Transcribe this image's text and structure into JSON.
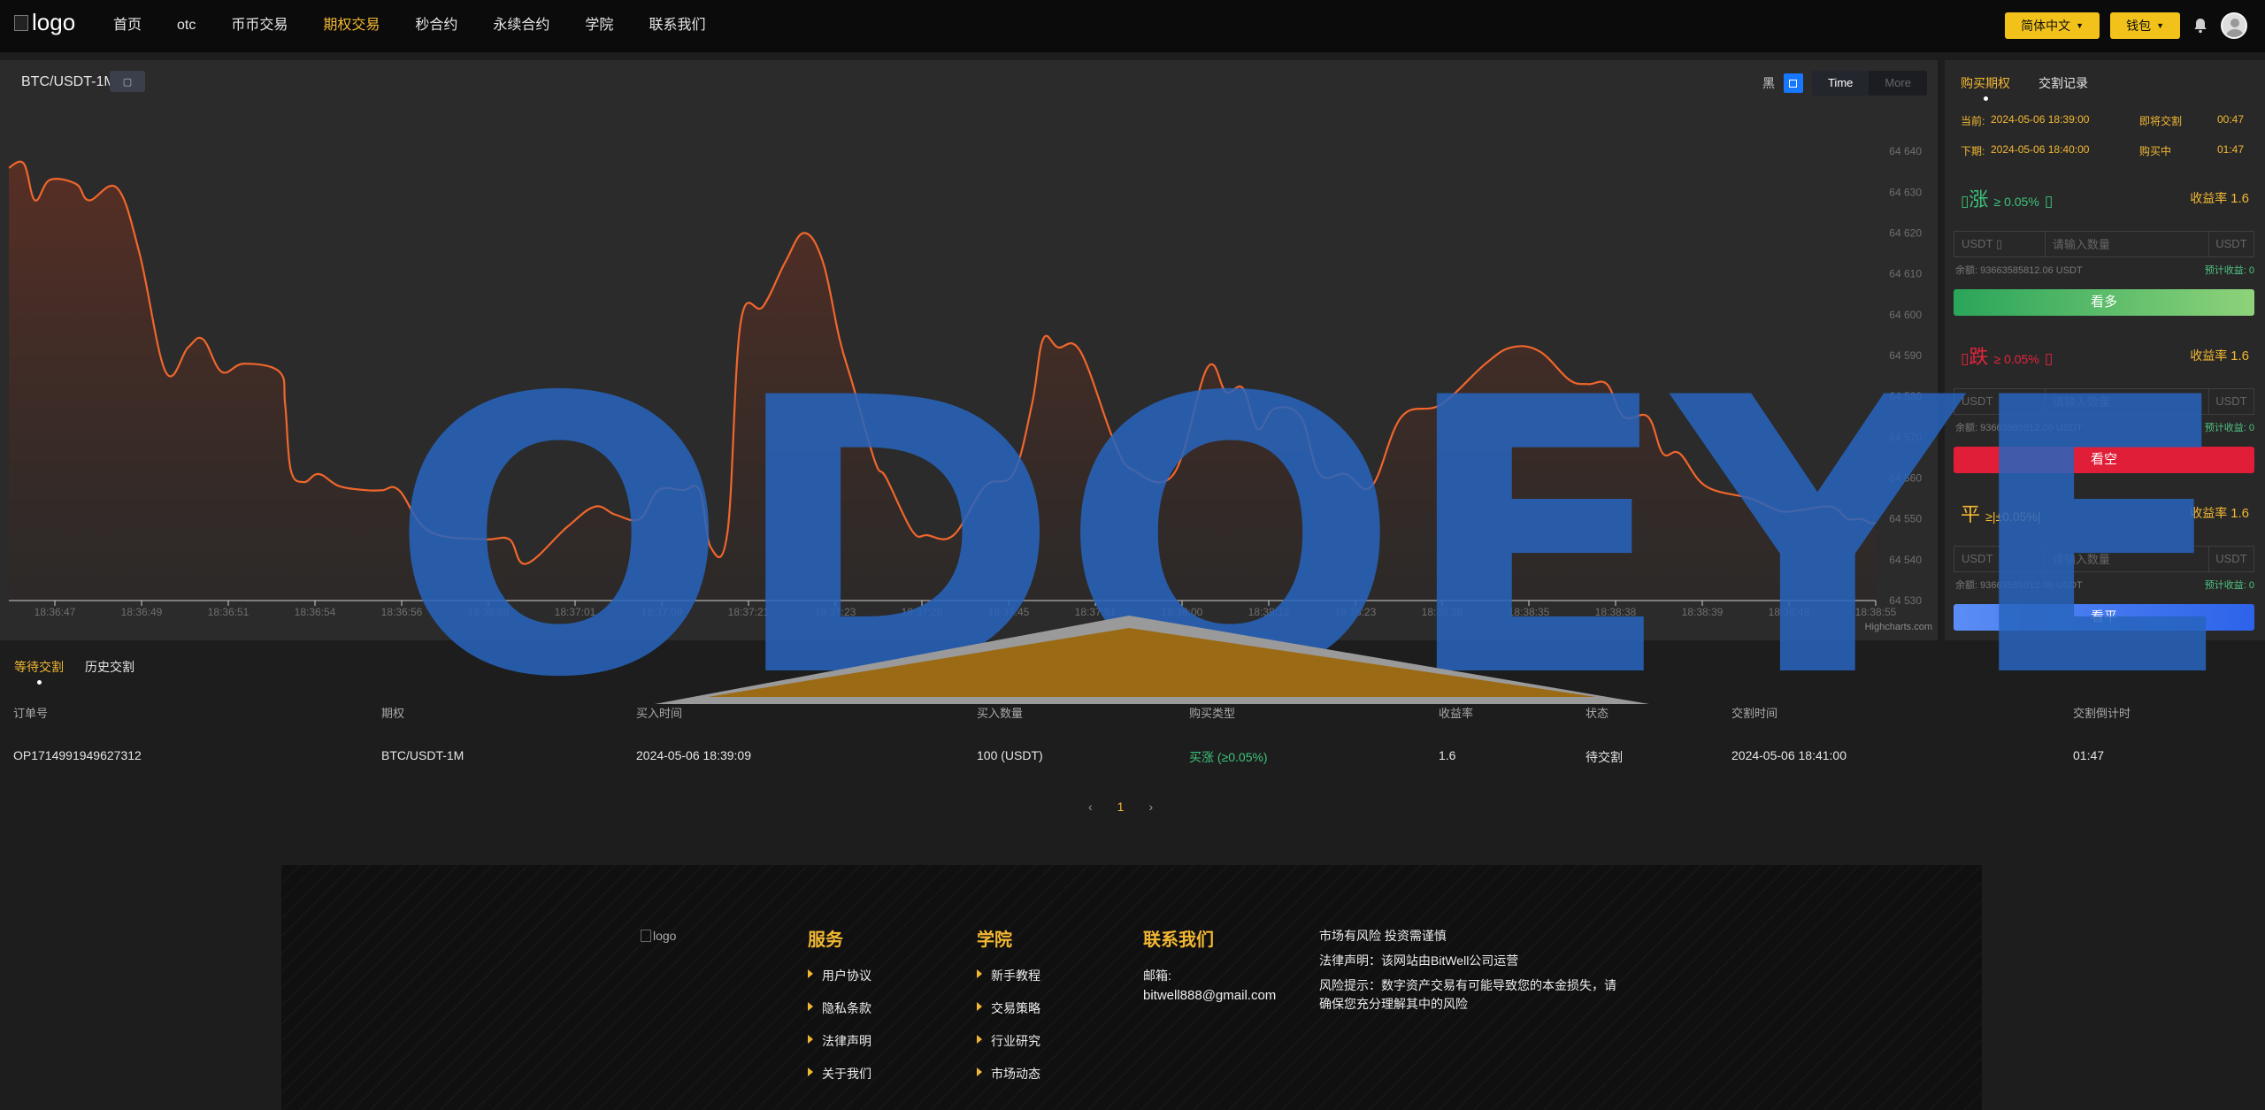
{
  "header": {
    "logo_alt": "logo",
    "nav": [
      {
        "label": "首页",
        "active": false
      },
      {
        "label": "otc",
        "active": false
      },
      {
        "label": "币币交易",
        "active": false
      },
      {
        "label": "期权交易",
        "active": true
      },
      {
        "label": "秒合约",
        "active": false
      },
      {
        "label": "永续合约",
        "active": false
      },
      {
        "label": "学院",
        "active": false
      },
      {
        "label": "联系我们",
        "active": false
      }
    ],
    "language_btn": "简体中文",
    "wallet_btn": "钱包",
    "bell_icon": "bell-icon",
    "avatar_icon": "user-avatar-icon"
  },
  "chart": {
    "title": "BTC/USDT-1M",
    "theme_label": "黑",
    "segments": [
      {
        "label": "Time",
        "active": true
      },
      {
        "label": "More",
        "active": false
      }
    ],
    "credit": "Highcharts.com",
    "colors": {
      "line": "#f0662c",
      "area_top": "#5a2f24",
      "area_bottom": "#2d2826",
      "axis": "#cfcfcf",
      "tick_text": "#6f6f6f"
    }
  },
  "chart_data": {
    "type": "area",
    "title": "BTC/USDT-1M",
    "ylim": [
      64530,
      64645
    ],
    "y_ticks": [
      64530,
      64540,
      64550,
      64560,
      64570,
      64580,
      64590,
      64600,
      64610,
      64620,
      64630,
      64640
    ],
    "y_tick_labels": [
      "64 530",
      "64 540",
      "64 550",
      "64 560",
      "64 570",
      "64 580",
      "64 590",
      "64 600",
      "64 610",
      "64 620",
      "64 630",
      "64 640"
    ],
    "x_tick_labels": [
      "18:36:47",
      "18:36:49",
      "18:36:51",
      "18:36:54",
      "18:36:56",
      "18:36:59",
      "18:37:01",
      "18:37:09",
      "18:37:21",
      "18:37:23",
      "18:37:26",
      "18:37:45",
      "18:37:51",
      "18:38:00",
      "18:38:12",
      "18:38:23",
      "18:38:28",
      "18:38:35",
      "18:38:38",
      "18:38:39",
      "18:38:48",
      "18:38:55"
    ],
    "series": [
      {
        "x": [
          0,
          0.8,
          1.4,
          2.2,
          3.6,
          4.3,
          5.8,
          7,
          8.4,
          9.6,
          10.4,
          11.4,
          12.6,
          14.5,
          14.8,
          15.1,
          15.8,
          16.6,
          17.7,
          19.2,
          20,
          20.9,
          22.5,
          25.4,
          26.8,
          27.7,
          29.9,
          31.4,
          32.5,
          33.8,
          34.8,
          36.1,
          37,
          37.6,
          38.5,
          39.2,
          40.4,
          41.6,
          42.6,
          43.6,
          44.5,
          45.2,
          46.4,
          47,
          48.4,
          49.2,
          50.6,
          52.3,
          53.8,
          54.8,
          55.4,
          56.2,
          57.4,
          59.2,
          60.2,
          62.4,
          64.2,
          65.2,
          66.1,
          66.9,
          67.8,
          69.2,
          70.2,
          71.6,
          73,
          74.6,
          76.7,
          79.1,
          80.5,
          82,
          83.6,
          84.6,
          85.6,
          86.5,
          87.8,
          88.6,
          89.5,
          90.9,
          93.3,
          94.8,
          95.8,
          97.6,
          98.5,
          99.2,
          99.7,
          100
        ],
        "y": [
          64636,
          64637,
          64628,
          64633,
          64632,
          64628,
          64631,
          64615,
          64586,
          64592,
          64594,
          64586,
          64588,
          64586,
          64578,
          64562,
          64559,
          64561,
          64558,
          64557,
          64557,
          64557,
          64547,
          64545,
          64545,
          64539,
          64548,
          64553,
          64551,
          64550,
          64557,
          64557,
          64557,
          64543,
          64547,
          64598,
          64602,
          64613,
          64620,
          64613,
          64594,
          64583,
          64564,
          64560,
          64547,
          64546,
          64546,
          64558,
          64561,
          64578,
          64594,
          64592,
          64591,
          64569,
          64562,
          64561,
          64587,
          64581,
          64582,
          64572,
          64577,
          64575,
          64561,
          64561,
          64558,
          64575,
          64578,
          64588,
          64592,
          64591,
          64584,
          64583,
          64583,
          64575,
          64575,
          64566,
          64566,
          64558,
          64555,
          64552,
          64552,
          64553,
          64550,
          64550,
          64549,
          64549
        ]
      }
    ]
  },
  "options_panel": {
    "tabs": [
      {
        "label": "购买期权",
        "active": true
      },
      {
        "label": "交割记录",
        "active": false
      }
    ],
    "current_label": "当前:",
    "current_time": "2024-05-06 18:39:00",
    "current_status": "即将交割",
    "current_countdown": "00:47",
    "next_label": "下期:",
    "next_time": "2024-05-06 18:40:00",
    "next_status": "购买中",
    "next_countdown": "01:47",
    "options": [
      {
        "symbol": "涨",
        "condition": "≥ 0.05%",
        "rate_label": "收益率",
        "rate": "1.6",
        "currency": "USDT",
        "placeholder": "请输入数量",
        "unit": "USDT",
        "balance_label": "余额:",
        "balance": "93663585812.06 USDT",
        "expected_label": "预计收益:",
        "expected": "0",
        "button": "看多",
        "color": "#39b66a"
      },
      {
        "symbol": "跌",
        "condition": "≥ 0.05%",
        "rate_label": "收益率",
        "rate": "1.6",
        "currency": "USDT",
        "placeholder": "请输入数量",
        "unit": "USDT",
        "balance_label": "余额:",
        "balance": "93663585812.06 USDT",
        "expected_label": "预计收益:",
        "expected": "0",
        "button": "看空",
        "color": "#e8243c"
      },
      {
        "symbol": "平",
        "condition": "≥|±0.05%|",
        "rate_label": "收益率",
        "rate": "1.6",
        "currency": "USDT",
        "placeholder": "请输入数量",
        "unit": "USDT",
        "balance_label": "余额:",
        "balance": "93663585812.06 USDT",
        "expected_label": "预计收益:",
        "expected": "0",
        "button": "看平",
        "color": "#f3b833"
      }
    ]
  },
  "orders": {
    "tabs": [
      {
        "label": "等待交割",
        "active": true
      },
      {
        "label": "历史交割",
        "active": false
      }
    ],
    "columns": [
      "订单号",
      "期权",
      "买入时间",
      "买入数量",
      "购买类型",
      "收益率",
      "状态",
      "交割时间",
      "交割倒计时"
    ],
    "rows": [
      [
        "OP1714991949627312",
        "BTC/USDT-1M",
        "2024-05-06 18:39:09",
        "100 (USDT)",
        "买涨 (≥0.05%)",
        "1.6",
        "待交割",
        "2024-05-06 18:41:00",
        "01:47"
      ]
    ],
    "pager": {
      "prev": "‹",
      "current": "1",
      "next": "›"
    }
  },
  "footer": {
    "logo_alt": "logo",
    "services_title": "服务",
    "services": [
      "用户协议",
      "隐私条款",
      "法律声明",
      "关于我们"
    ],
    "academy_title": "学院",
    "academy": [
      "新手教程",
      "交易策略",
      "行业研究",
      "市场动态"
    ],
    "contact_title": "联系我们",
    "email_label": "邮箱:",
    "email": "bitwell888@gmail.com",
    "risk_lines": [
      "市场有风险 投资需谨慎",
      "法律声明：该网站由BitWell公司运营",
      "风险提示：数字资产交易有可能导致您的本金损失，请确保您充分理解其中的风险"
    ]
  },
  "watermark": {
    "text": "ODOEYE"
  }
}
